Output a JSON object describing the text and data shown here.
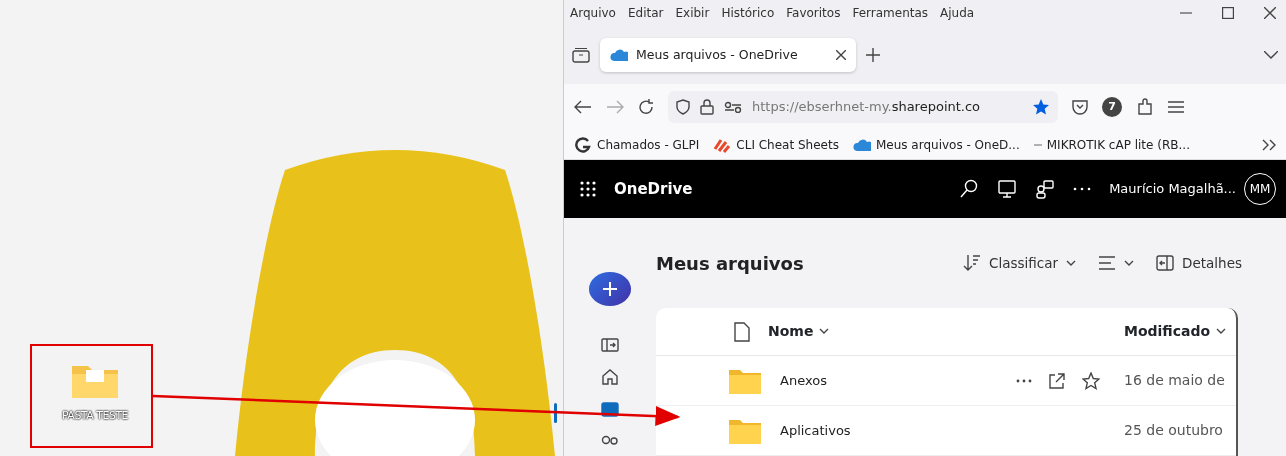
{
  "desktop": {
    "icon_label": "PASTA TESTE"
  },
  "browser": {
    "menu": [
      "Arquivo",
      "Editar",
      "Exibir",
      "Histórico",
      "Favoritos",
      "Ferramentas",
      "Ajuda"
    ],
    "tabs": [
      {
        "title": "Meus arquivos - OneDrive",
        "selected": true
      }
    ],
    "url": {
      "prefix": "https://ebserhnet-my.",
      "domain": "sharepoint.co"
    },
    "bookmarked": true,
    "extension_badge": "7",
    "bookmarks": [
      {
        "label": "Chamados - GLPI",
        "kind": "glpi"
      },
      {
        "label": "CLI Cheat Sheets",
        "kind": "cli"
      },
      {
        "label": "Meus arquivos - OneD...",
        "kind": "onedrive"
      },
      {
        "label": "MIKROTIK cAP lite (RB...",
        "kind": "blank"
      }
    ]
  },
  "onedrive": {
    "app_name": "OneDrive",
    "user": "Maurício Magalhã...",
    "avatar": "MM",
    "title": "Meus arquivos",
    "toolbar": [
      {
        "kind": "sort",
        "label": "Classificar"
      },
      {
        "kind": "view"
      },
      {
        "kind": "details",
        "label": "Detalhes"
      }
    ],
    "rail": [
      {
        "kind": "pane",
        "selected": false
      },
      {
        "kind": "home",
        "selected": false
      },
      {
        "kind": "files",
        "selected": true
      },
      {
        "kind": "people",
        "selected": false
      }
    ],
    "columns": [
      {
        "label": "Nome"
      },
      {
        "label": "Modificado"
      }
    ],
    "rows": [
      {
        "name": "Anexos",
        "modified": "16 de maio de",
        "show_actions": true
      },
      {
        "name": "Aplicativos",
        "modified": "25 de outubro",
        "show_actions": false
      }
    ]
  }
}
